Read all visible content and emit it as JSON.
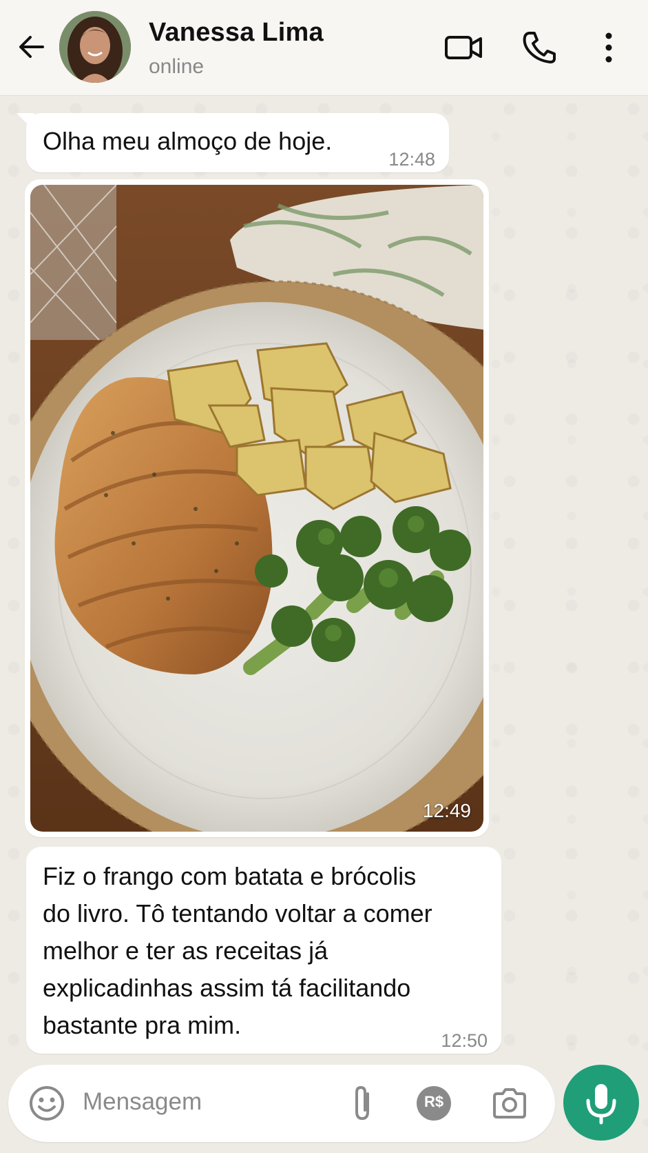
{
  "header": {
    "contact_name": "Vanessa Lima",
    "status": "online",
    "icons": [
      "back-arrow-icon",
      "avatar",
      "video-call-icon",
      "voice-call-icon",
      "more-options-icon"
    ]
  },
  "messages": [
    {
      "text": "Olha meu almoço de hoje.",
      "time": "12:48"
    },
    {
      "type": "image",
      "description_icon": "lunch-photo",
      "time": "12:49"
    },
    {
      "lines": [
        "Fiz o frango com batata e brócolis",
        "do livro. Tô tentando voltar a comer",
        "melhor e ter as receitas já",
        "explicadinhas assim tá facilitando",
        "bastante pra mim."
      ],
      "time": "12:50"
    }
  ],
  "composer": {
    "placeholder": "Mensagem",
    "payment_label": "R$",
    "icons": [
      "emoji-icon",
      "attach-icon",
      "payment-icon",
      "camera-icon",
      "mic-icon"
    ]
  },
  "colors": {
    "accent": "#1f9e77",
    "chat_bg": "#eeebe5",
    "bubble": "#ffffff"
  }
}
